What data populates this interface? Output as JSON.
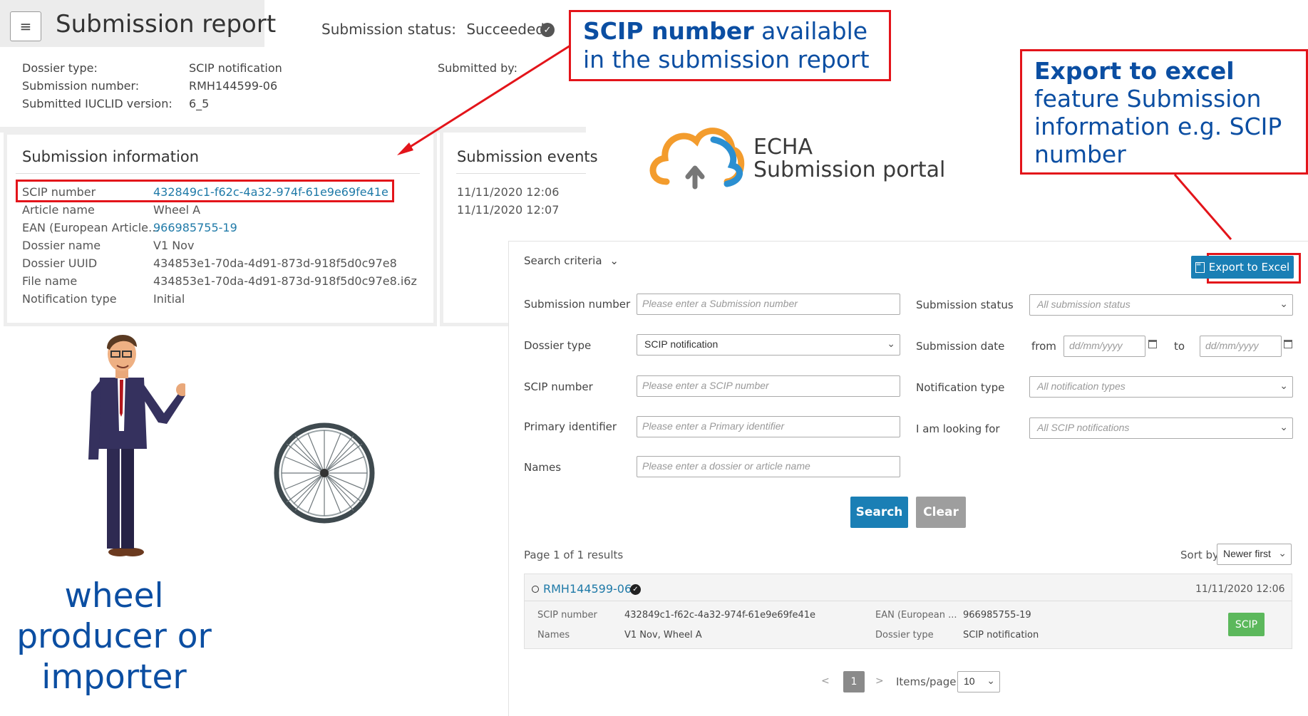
{
  "report": {
    "title": "Submission report",
    "status_label": "Submission status:",
    "status_value": "Succeeded",
    "submitted_by_label": "Submitted by:",
    "meta": [
      {
        "label": "Dossier type:",
        "value": "SCIP notification"
      },
      {
        "label": "Submission number:",
        "value": "RMH144599-06"
      },
      {
        "label": "Submitted IUCLID version:",
        "value": "6_5"
      }
    ],
    "info_title": "Submission information",
    "info_rows": [
      {
        "label": "SCIP number",
        "value": "432849c1-f62c-4a32-974f-61e9e69fe41e"
      },
      {
        "label": "Article name",
        "value": "Wheel A"
      },
      {
        "label": "EAN (European Article…",
        "value": "966985755-19"
      },
      {
        "label": "Dossier name",
        "value": "V1 Nov"
      },
      {
        "label": "Dossier UUID",
        "value": "434853e1-70da-4d91-873d-918f5d0c97e8"
      },
      {
        "label": "File name",
        "value": "434853e1-70da-4d91-873d-918f5d0c97e8.i6z"
      },
      {
        "label": "Notification type",
        "value": "Initial"
      }
    ],
    "events_title": "Submission events",
    "events": [
      "11/11/2020 12:06",
      "11/11/2020 12:07"
    ]
  },
  "callouts": {
    "scip_strong": "SCIP number",
    "scip_rest": " available",
    "scip_line2": "in the submission report",
    "export_strong": "Export to excel",
    "export_line2": "feature Submission",
    "export_line3": "information e.g. SCIP",
    "export_line4": "number",
    "persona_line1": "wheel",
    "persona_line2": "producer or",
    "persona_line3": "importer"
  },
  "logo": {
    "line1": "ECHA",
    "line2": "Submission portal"
  },
  "portal": {
    "search_criteria": "Search criteria",
    "export_button": "Export to Excel",
    "fields": {
      "submission_number": {
        "label": "Submission number",
        "placeholder": "Please enter a Submission number"
      },
      "dossier_type": {
        "label": "Dossier type",
        "value": "SCIP notification"
      },
      "scip_number": {
        "label": "SCIP number",
        "placeholder": "Please enter a SCIP number"
      },
      "primary_identifier": {
        "label": "Primary identifier",
        "placeholder": "Please enter a Primary identifier"
      },
      "names": {
        "label": "Names",
        "placeholder": "Please enter a dossier or article name"
      },
      "submission_status": {
        "label": "Submission status",
        "value": "All submission status"
      },
      "submission_date": {
        "label": "Submission date",
        "from": "from",
        "to": "to",
        "placeholder": "dd/mm/yyyy"
      },
      "notification_type": {
        "label": "Notification type",
        "value": "All notification types"
      },
      "looking_for": {
        "label": "I am looking for",
        "value": "All SCIP notifications"
      }
    },
    "search_button": "Search",
    "clear_button": "Clear",
    "results_count": "Page 1 of 1 results",
    "sort_label": "Sort by",
    "sort_value": "Newer first",
    "result": {
      "id": "RMH144599-06",
      "date": "11/11/2020 12:06",
      "scip_label": "SCIP number",
      "scip_value": "432849c1-f62c-4a32-974f-61e9e69fe41e",
      "names_label": "Names",
      "names_value": "V1 Nov, Wheel A",
      "ean_label": "EAN (European ...",
      "ean_value": "966985755-19",
      "dossier_label": "Dossier type",
      "dossier_value": "SCIP notification",
      "badge": "SCIP"
    },
    "pagination": {
      "prev": "<",
      "page": "1",
      "next": ">",
      "items_label": "Items/page",
      "items_value": "10"
    }
  },
  "colors": {
    "accent_blue": "#1a6fa0",
    "callout_red": "#e3141a",
    "callout_text": "#0b4ea2",
    "scip_badge": "#5cb85c",
    "clear_gray": "#9e9e9e"
  }
}
